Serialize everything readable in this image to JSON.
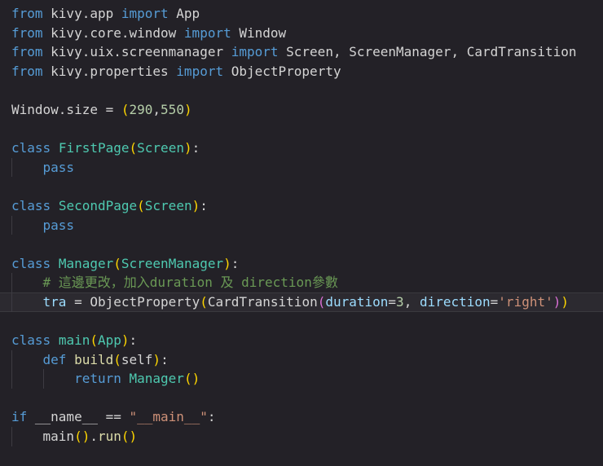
{
  "editor": {
    "name": "python-code-editor",
    "background": "#232127",
    "indent_guide_color": "#3d3b42",
    "palette": {
      "kw": "#569cd6",
      "pl": "#d4d4d4",
      "cls": "#4ec9b0",
      "fn": "#dcdcaa",
      "num": "#b5cea8",
      "str": "#ce9178",
      "cm": "#6a9955",
      "p1": "#ffd700",
      "p2": "#da70d6",
      "var": "#9cdcfe"
    },
    "lines": [
      {
        "guides": [],
        "tokens": [
          {
            "t": "from",
            "c": "kw"
          },
          {
            "t": " kivy.app ",
            "c": "pl"
          },
          {
            "t": "import",
            "c": "kw"
          },
          {
            "t": " App",
            "c": "pl"
          }
        ]
      },
      {
        "guides": [],
        "tokens": [
          {
            "t": "from",
            "c": "kw"
          },
          {
            "t": " kivy.core.window ",
            "c": "pl"
          },
          {
            "t": "import",
            "c": "kw"
          },
          {
            "t": " Window",
            "c": "pl"
          }
        ]
      },
      {
        "guides": [],
        "tokens": [
          {
            "t": "from",
            "c": "kw"
          },
          {
            "t": " kivy.uix.screenmanager ",
            "c": "pl"
          },
          {
            "t": "import",
            "c": "kw"
          },
          {
            "t": " Screen, ScreenManager, CardTransition",
            "c": "pl"
          }
        ]
      },
      {
        "guides": [],
        "tokens": [
          {
            "t": "from",
            "c": "kw"
          },
          {
            "t": " kivy.properties ",
            "c": "pl"
          },
          {
            "t": "import",
            "c": "kw"
          },
          {
            "t": " ObjectProperty",
            "c": "pl"
          }
        ]
      },
      {
        "guides": [],
        "tokens": []
      },
      {
        "guides": [],
        "tokens": [
          {
            "t": "Window.size = ",
            "c": "pl"
          },
          {
            "t": "(",
            "c": "p1"
          },
          {
            "t": "290",
            "c": "num"
          },
          {
            "t": ",",
            "c": "pl"
          },
          {
            "t": "550",
            "c": "num"
          },
          {
            "t": ")",
            "c": "p1"
          }
        ]
      },
      {
        "guides": [],
        "tokens": []
      },
      {
        "guides": [],
        "tokens": [
          {
            "t": "class",
            "c": "kw"
          },
          {
            "t": " ",
            "c": "pl"
          },
          {
            "t": "FirstPage",
            "c": "cls"
          },
          {
            "t": "(",
            "c": "p1"
          },
          {
            "t": "Screen",
            "c": "cls"
          },
          {
            "t": ")",
            "c": "p1"
          },
          {
            "t": ":",
            "c": "pl"
          }
        ]
      },
      {
        "guides": [
          0
        ],
        "tokens": [
          {
            "t": "    ",
            "c": "pl"
          },
          {
            "t": "pass",
            "c": "kw"
          }
        ]
      },
      {
        "guides": [],
        "tokens": []
      },
      {
        "guides": [],
        "tokens": [
          {
            "t": "class",
            "c": "kw"
          },
          {
            "t": " ",
            "c": "pl"
          },
          {
            "t": "SecondPage",
            "c": "cls"
          },
          {
            "t": "(",
            "c": "p1"
          },
          {
            "t": "Screen",
            "c": "cls"
          },
          {
            "t": ")",
            "c": "p1"
          },
          {
            "t": ":",
            "c": "pl"
          }
        ]
      },
      {
        "guides": [
          0
        ],
        "tokens": [
          {
            "t": "    ",
            "c": "pl"
          },
          {
            "t": "pass",
            "c": "kw"
          }
        ]
      },
      {
        "guides": [],
        "tokens": []
      },
      {
        "guides": [],
        "tokens": [
          {
            "t": "class",
            "c": "kw"
          },
          {
            "t": " ",
            "c": "pl"
          },
          {
            "t": "Manager",
            "c": "cls"
          },
          {
            "t": "(",
            "c": "p1"
          },
          {
            "t": "ScreenManager",
            "c": "cls"
          },
          {
            "t": ")",
            "c": "p1"
          },
          {
            "t": ":",
            "c": "pl"
          }
        ]
      },
      {
        "guides": [
          0
        ],
        "tokens": [
          {
            "t": "    ",
            "c": "pl"
          },
          {
            "t": "# 這邊更改，加入duration 及 direction參數",
            "c": "cm"
          }
        ]
      },
      {
        "guides": [
          0
        ],
        "highlight": true,
        "tokens": [
          {
            "t": "    ",
            "c": "pl"
          },
          {
            "t": "tra",
            "c": "var"
          },
          {
            "t": " = ",
            "c": "pl"
          },
          {
            "t": "ObjectProperty",
            "c": "pl"
          },
          {
            "t": "(",
            "c": "p1"
          },
          {
            "t": "CardTransition",
            "c": "pl"
          },
          {
            "t": "(",
            "c": "p2"
          },
          {
            "t": "duration",
            "c": "var"
          },
          {
            "t": "=",
            "c": "pl"
          },
          {
            "t": "3",
            "c": "num"
          },
          {
            "t": ", ",
            "c": "pl"
          },
          {
            "t": "direction",
            "c": "var"
          },
          {
            "t": "=",
            "c": "pl"
          },
          {
            "t": "'right'",
            "c": "str"
          },
          {
            "t": ")",
            "c": "p2"
          },
          {
            "t": ")",
            "c": "p1"
          }
        ]
      },
      {
        "guides": [],
        "tokens": []
      },
      {
        "guides": [],
        "tokens": [
          {
            "t": "class",
            "c": "kw"
          },
          {
            "t": " ",
            "c": "pl"
          },
          {
            "t": "main",
            "c": "cls"
          },
          {
            "t": "(",
            "c": "p1"
          },
          {
            "t": "App",
            "c": "cls"
          },
          {
            "t": ")",
            "c": "p1"
          },
          {
            "t": ":",
            "c": "pl"
          }
        ]
      },
      {
        "guides": [
          0
        ],
        "tokens": [
          {
            "t": "    ",
            "c": "pl"
          },
          {
            "t": "def",
            "c": "kw"
          },
          {
            "t": " ",
            "c": "pl"
          },
          {
            "t": "build",
            "c": "fn"
          },
          {
            "t": "(",
            "c": "p1"
          },
          {
            "t": "self",
            "c": "pl"
          },
          {
            "t": ")",
            "c": "p1"
          },
          {
            "t": ":",
            "c": "pl"
          }
        ]
      },
      {
        "guides": [
          0,
          4
        ],
        "tokens": [
          {
            "t": "        ",
            "c": "pl"
          },
          {
            "t": "return",
            "c": "kw"
          },
          {
            "t": " ",
            "c": "pl"
          },
          {
            "t": "Manager",
            "c": "cls"
          },
          {
            "t": "()",
            "c": "p1"
          }
        ]
      },
      {
        "guides": [],
        "tokens": []
      },
      {
        "guides": [],
        "tokens": [
          {
            "t": "if",
            "c": "kw"
          },
          {
            "t": " __name__ == ",
            "c": "pl"
          },
          {
            "t": "\"__main__\"",
            "c": "str"
          },
          {
            "t": ":",
            "c": "pl"
          }
        ]
      },
      {
        "guides": [
          0
        ],
        "tokens": [
          {
            "t": "    ",
            "c": "pl"
          },
          {
            "t": "main",
            "c": "pl"
          },
          {
            "t": "()",
            "c": "p1"
          },
          {
            "t": ".",
            "c": "pl"
          },
          {
            "t": "run",
            "c": "fn"
          },
          {
            "t": "()",
            "c": "p1"
          }
        ]
      },
      {
        "guides": [],
        "tokens": []
      }
    ]
  }
}
